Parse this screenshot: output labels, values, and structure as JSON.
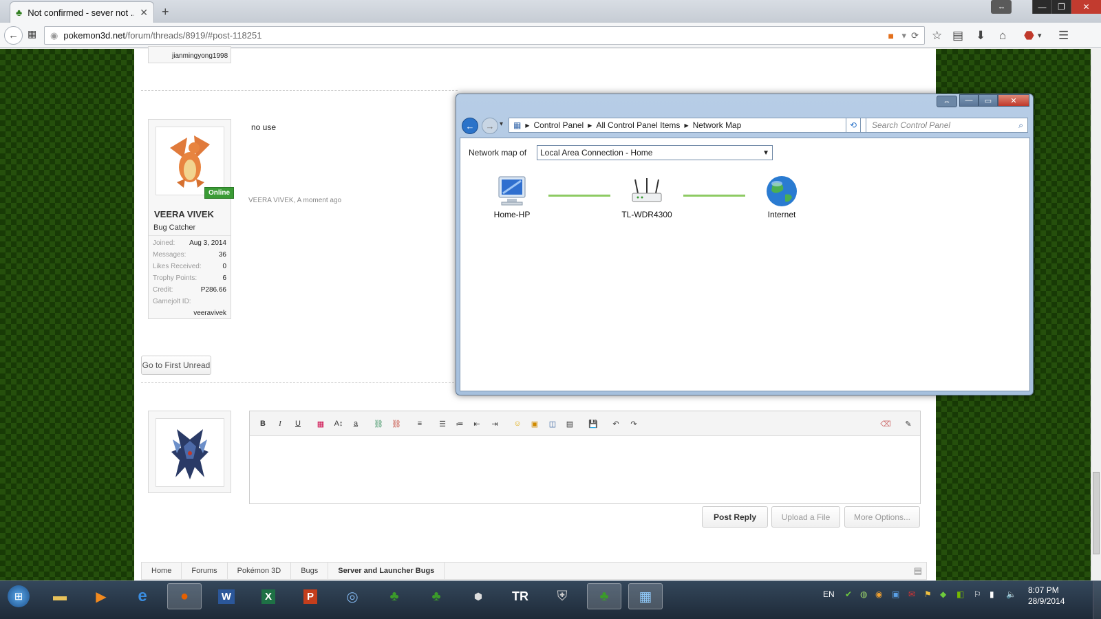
{
  "browser": {
    "tab_title": "Not confirmed - sever not ...",
    "url_host": "pokemon3d.net",
    "url_path": "/forum/threads/8919/#post-118251"
  },
  "post": {
    "prev_username": "jianmingyong1998",
    "message": "no use",
    "author_line": "VEERA VIVEK, A moment ago",
    "username": "VEERA VIVEK",
    "user_title": "Bug Catcher",
    "online_badge": "Online",
    "stats": [
      {
        "label": "Joined:",
        "value": "Aug 3, 2014"
      },
      {
        "label": "Messages:",
        "value": "36"
      },
      {
        "label": "Likes Received:",
        "value": "0"
      },
      {
        "label": "Trophy Points:",
        "value": "6"
      },
      {
        "label": "Credit:",
        "value": "P286.66"
      },
      {
        "label": "Gamejolt ID:",
        "value": ""
      }
    ],
    "gamejolt_id": "veeravivek",
    "first_unread_label": "Go to First Unread"
  },
  "editor": {
    "post_reply": "Post Reply",
    "upload_file": "Upload a File",
    "more_options": "More Options..."
  },
  "breadcrumbs": [
    "Home",
    "Forums",
    "Pokémon 3D",
    "Bugs",
    "Server and Launcher Bugs"
  ],
  "explorer": {
    "path": [
      "Control Panel",
      "All Control Panel Items",
      "Network Map"
    ],
    "search_placeholder": "Search Control Panel",
    "network_map_label": "Network map of",
    "connection": "Local Area Connection - Home",
    "nodes": [
      "Home-HP",
      "TL-WDR4300",
      "Internet"
    ]
  },
  "taskbar": {
    "lang": "EN",
    "time": "8:07 PM",
    "date": "28/9/2014"
  },
  "colors": {
    "online": "#3a9b35",
    "link_line": "#97d16e",
    "close_red": "#c23b2f"
  }
}
